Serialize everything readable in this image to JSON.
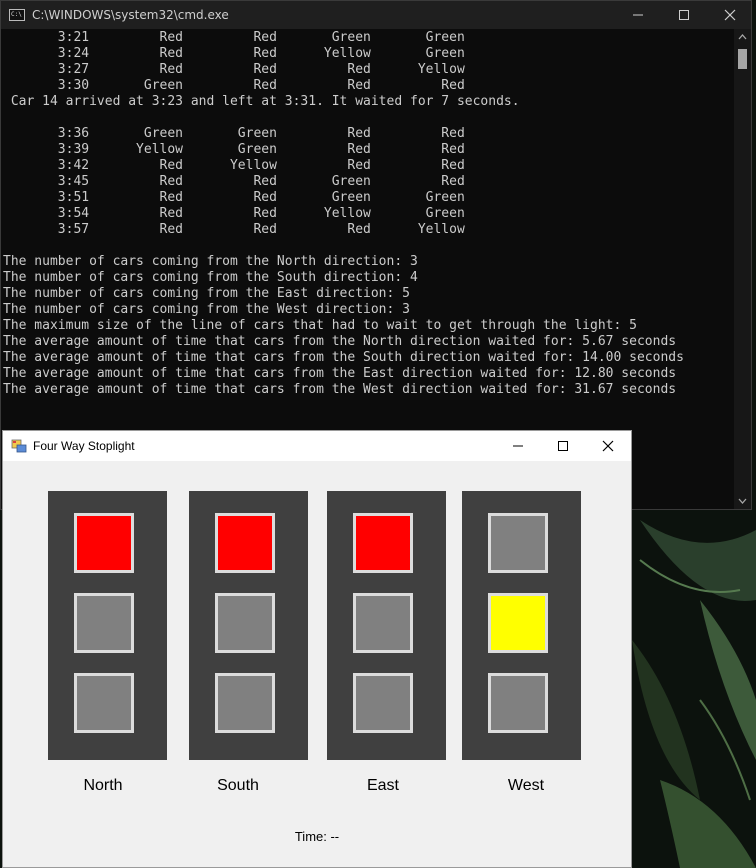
{
  "console_window": {
    "title": "C:\\WINDOWS\\system32\\cmd.exe",
    "output": "       3:21         Red         Red       Green       Green\n       3:24         Red         Red      Yellow       Green\n       3:27         Red         Red         Red      Yellow\n       3:30       Green         Red         Red         Red\n Car 14 arrived at 3:23 and left at 3:31. It waited for 7 seconds.\n\n       3:36       Green       Green         Red         Red\n       3:39      Yellow       Green         Red         Red\n       3:42         Red      Yellow         Red         Red\n       3:45         Red         Red       Green         Red\n       3:51         Red         Red       Green       Green\n       3:54         Red         Red      Yellow       Green\n       3:57         Red         Red         Red      Yellow\n\nThe number of cars coming from the North direction: 3\nThe number of cars coming from the South direction: 4\nThe number of cars coming from the East direction: 5\nThe number of cars coming from the West direction: 3\nThe maximum size of the line of cars that had to wait to get through the light: 5\nThe average amount of time that cars from the North direction waited for: 5.67 seconds\nThe average amount of time that cars from the South direction waited for: 14.00 seconds\nThe average amount of time that cars from the East direction waited for: 12.80 seconds\nThe average amount of time that cars from the West direction waited for: 31.67 seconds"
  },
  "stoplight_window": {
    "title": "Four Way Stoplight",
    "directions": [
      {
        "label": "North",
        "lamps": [
          "#ff0000",
          "#808080",
          "#808080"
        ]
      },
      {
        "label": "South",
        "lamps": [
          "#ff0000",
          "#808080",
          "#808080"
        ]
      },
      {
        "label": "East",
        "lamps": [
          "#ff0000",
          "#808080",
          "#808080"
        ]
      },
      {
        "label": "West",
        "lamps": [
          "#808080",
          "#ffff00",
          "#808080"
        ]
      }
    ],
    "time_text": "Time: --"
  },
  "colors": {
    "console_bg": "#0c0c0c",
    "console_text": "#cccccc",
    "light_housing": "#404040",
    "lamp_border": "#dcdcdc",
    "red_on": "#ff0000",
    "yellow_on": "#ffff00",
    "lamp_off": "#808080"
  }
}
